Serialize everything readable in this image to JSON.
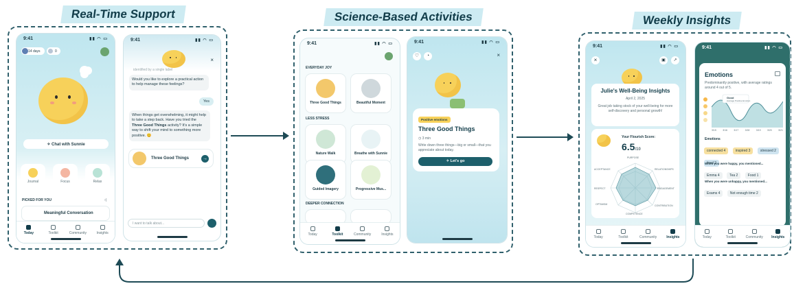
{
  "sections": {
    "support": "Real-Time Support",
    "activities": "Science-Based Activities",
    "insights": "Weekly Insights"
  },
  "colors": {
    "accent": "#1d5f6b",
    "sky": "#bfe4ee",
    "sun": "#f7d15a",
    "bg_dark": "#2f5f6b"
  },
  "status_time": "9:41",
  "tabs": [
    "Today",
    "Toolkit",
    "Community",
    "Insights"
  ],
  "phone1": {
    "days_badge": "14 days",
    "streak_badge": "0",
    "chat_button": "Chat with Sunnie",
    "quick": [
      "Journal",
      "Focus",
      "Relax"
    ],
    "picked_label": "PICKED FOR YOU",
    "picked_more": "›|",
    "picked_title": "Meaningful Conversation"
  },
  "phone2": {
    "line_top": "identified by a single label",
    "q1": "Would you like to explore a practical action to help manage these feelings?",
    "yes": "Yes",
    "msg_a": "When things get overwhelming, it might help to take a step back. Have you tried the",
    "msg_bold": "Three Good Things",
    "msg_b": "activity? It's a simple way to shift your mind to something more positive. 😊",
    "card_label": "Three Good Things",
    "input_placeholder": "I want to talk about..."
  },
  "phone3": {
    "sections": [
      "EVERYDAY JOY",
      "LESS STRESS",
      "DEEPER CONNECTION"
    ],
    "cards": [
      "Three Good Things",
      "Beautiful Moment",
      "Nature Walk",
      "Breathe with Sunnie",
      "Guided Imagery",
      "Progressive Mus..."
    ]
  },
  "phone4": {
    "tag": "Positive emotions",
    "title": "Three Good Things",
    "duration": "3 min",
    "desc": "Write down three things—big or small—that you appreciate about today.",
    "cta": "Let's go"
  },
  "phone5": {
    "title": "Julie's Well-Being Insights",
    "date": "April 2, 2025",
    "body": "Great job taking stock of your well-being for more self-discovery and personal growth!",
    "score_label": "Your Flourish Score:",
    "score": "6.5",
    "score_of": "/10",
    "radar_labels": [
      "PURPOSE",
      "RELATIONSHIPS",
      "ENGAGEMENT",
      "CONTRIBUTION",
      "COMPETENCE",
      "OPTIMISM",
      "RESPECT",
      "ACCEPTANCE"
    ]
  },
  "phone6": {
    "title": "Emotions",
    "subtitle": "Predominantly positive, with average ratings around 4 out of 5.",
    "tooltip_title": "Good",
    "tooltip_sub": "Average Positive Emotion",
    "x_labels": [
      "3/15",
      "3/16",
      "3/17",
      "3/18",
      "3/19",
      "3/20",
      "3/21"
    ],
    "emotions_label": "Emotions",
    "emotions": [
      {
        "t": "connected",
        "n": "4"
      },
      {
        "t": "inspired",
        "n": "3"
      },
      {
        "t": "stressed",
        "n": "2"
      },
      {
        "t": "tired",
        "n": "2"
      }
    ],
    "happy_label": "When you were happy, you mentioned...",
    "happy": [
      {
        "t": "Emma",
        "n": "4"
      },
      {
        "t": "Tea",
        "n": "2"
      },
      {
        "t": "Food",
        "n": "1"
      }
    ],
    "unhappy_label": "When you were unhappy, you mentioned...",
    "unhappy": [
      {
        "t": "Exams",
        "n": "4"
      },
      {
        "t": "Not enough time",
        "n": "2"
      }
    ]
  }
}
